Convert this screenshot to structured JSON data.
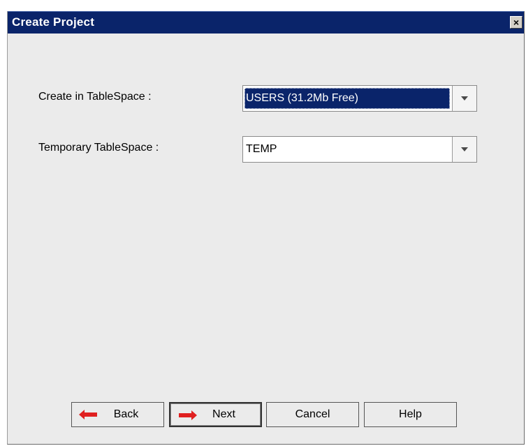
{
  "window": {
    "title": "Create Project",
    "close_glyph": "×"
  },
  "form": {
    "tablespace": {
      "label": "Create in TableSpace :",
      "value": "USERS (31.2Mb Free)"
    },
    "temp_tablespace": {
      "label": "Temporary TableSpace :",
      "value": "TEMP"
    }
  },
  "buttons": {
    "back": "Back",
    "next": "Next",
    "cancel": "Cancel",
    "help": "Help"
  },
  "colors": {
    "titlebar": "#0a246a",
    "selection": "#0a246a",
    "arrow_icon": "#e02020",
    "panel": "#ebebeb"
  }
}
